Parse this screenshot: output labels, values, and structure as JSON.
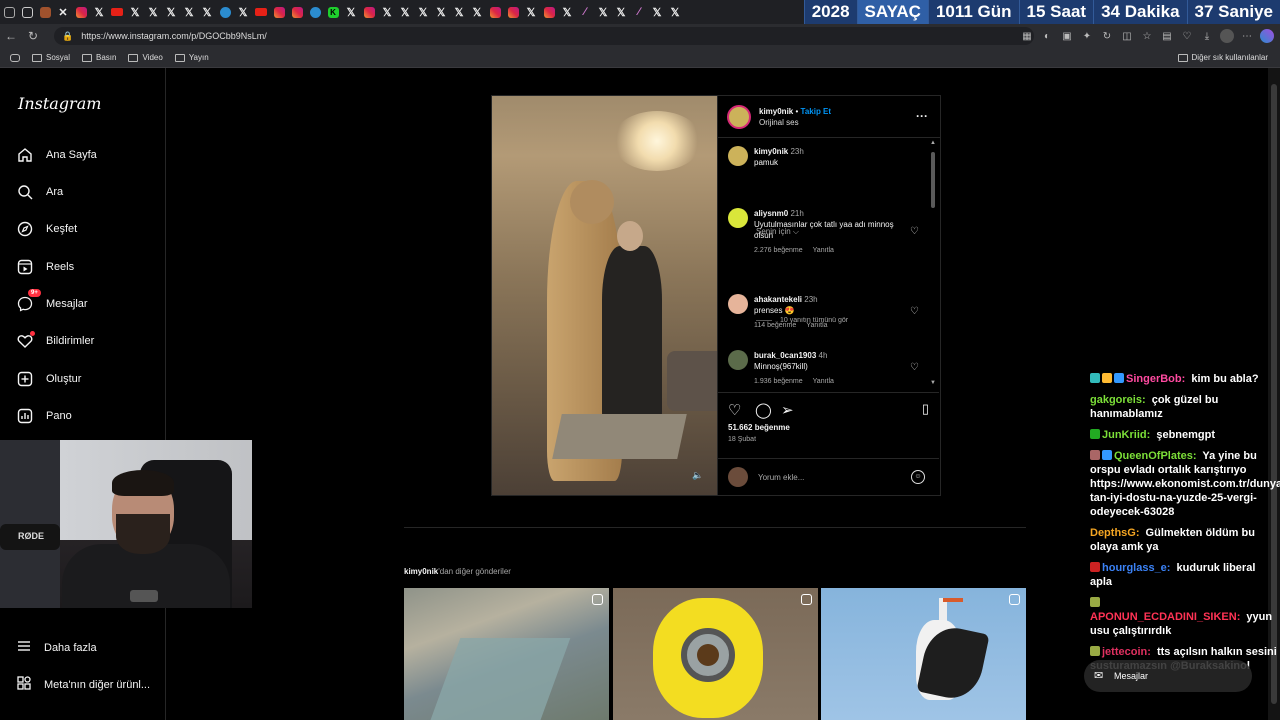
{
  "countdown": {
    "year": "2028",
    "label": "SAYAÇ",
    "days": "1011 Gün",
    "hours": "15 Saat",
    "minutes": "34 Dakika",
    "seconds": "37 Saniye"
  },
  "address": {
    "url": "https://www.instagram.com/p/DGOCbb9NsLm/"
  },
  "bookmarks": {
    "items": [
      "Sosyal",
      "Basın",
      "Video",
      "Yayın"
    ],
    "other": "Diğer sık kullanılanlar"
  },
  "sidebar": {
    "logo": "Instagram",
    "items": [
      "Ana Sayfa",
      "Ara",
      "Keşfet",
      "Reels",
      "Mesajlar",
      "Bildirimler",
      "Oluştur",
      "Pano"
    ],
    "messages_badge": "9+",
    "more": "Daha fazla",
    "meta": "Meta'nın diğer ürünl..."
  },
  "webcam": {
    "mic_brand": "RØDE"
  },
  "post": {
    "author": "kimy0nik",
    "separator": "•",
    "follow": "Takip Et",
    "audio": "Orijinal ses",
    "more_glyph": "···",
    "caption_user": "kimy0nik",
    "caption_time": "23h",
    "caption": "pamuk",
    "sort": "Senin için ⌵",
    "comments": [
      {
        "user": "aliysnm0",
        "time": "21h",
        "text": "Uyutulmasınlar çok tatlı yaa adı minnoş olsun",
        "likes": "2.276 beğenme",
        "reply": "Yanıtla"
      },
      {
        "user": "ahakantekeli",
        "time": "23h",
        "text": "prenses 😍",
        "likes": "114 beğenme",
        "reply": "Yanıtla"
      },
      {
        "user": "burak_0can1903",
        "time": "4h",
        "text": "Minnoş(967kill)",
        "likes": "1.936 beğenme",
        "reply": "Yanıtla"
      }
    ],
    "view_replies": "10 yanıtın tümünü gör",
    "likes_total": "51.662 beğenme",
    "date": "18 Şubat",
    "add_comment_placeholder": "Yorum ekle..."
  },
  "more_posts": {
    "user": "kimy0nik",
    "suffix": "'dan diğer gönderiler"
  },
  "chat": [
    {
      "user": "SingerBob:",
      "msg": " kim bu abla?",
      "color": "#ff4aa0"
    },
    {
      "user": "gakgoreis:",
      "msg": " çok güzel bu hanımablamız",
      "color": "#7cdf38"
    },
    {
      "user": "JunKriid:",
      "msg": " şebnemgpt",
      "color": "#7cdf38"
    },
    {
      "user": "QueenOfPlates:",
      "msg": " Ya yine bu orspu evladı ortalık karıştırıyo https://www.ekonomist.com.tr/dunya/trump-tan-iyi-dostu-na-yuzde-25-vergi-odeyecek-63028",
      "color": "#7cdf38"
    },
    {
      "user": "DepthsG:",
      "msg": " Gülmekten öldüm bu olaya amk ya",
      "color": "#f5a623"
    },
    {
      "user": "hourglass_e:",
      "msg": " kuduruk liberal apla",
      "color": "#3b82f6"
    },
    {
      "user": "APONUN_ECDADINI_SIKEN:",
      "msg": " yyun usu çalıştırırdık",
      "color": "#ff3355"
    },
    {
      "user": "jettecoin:",
      "msg": " tts açılsın halkın sesini susturamazsın @Buraksakinol",
      "color": "#e03060"
    }
  ],
  "messages_pill": "Mesajlar"
}
